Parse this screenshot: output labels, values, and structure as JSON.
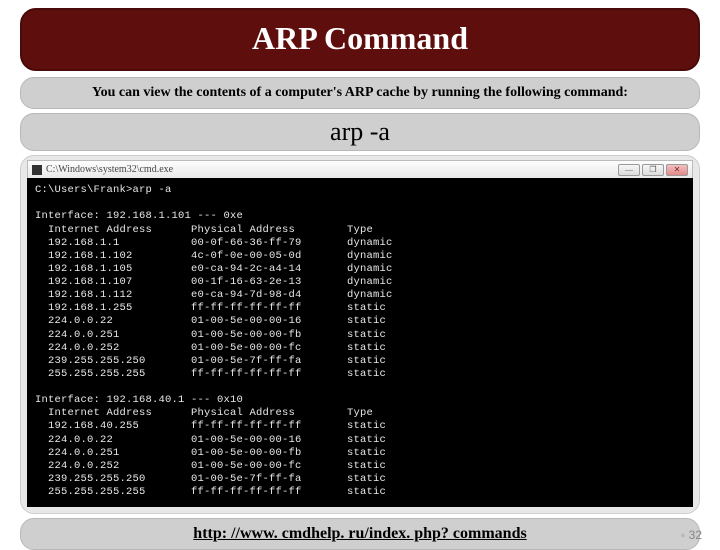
{
  "title": "ARP Command",
  "subtitle": "You can view the contents of a computer's ARP cache by running the following command:",
  "command": "arp -a",
  "window_title": "C:\\Windows\\system32\\cmd.exe",
  "prompt_line": "C:\\Users\\Frank>arp -a",
  "interfaces": [
    {
      "header": "Interface: 192.168.1.101 --- 0xe",
      "col1": "Internet Address",
      "col2": "Physical Address",
      "col3": "Type",
      "rows": [
        {
          "ip": "192.168.1.1",
          "mac": "00-0f-66-36-ff-79",
          "type": "dynamic"
        },
        {
          "ip": "192.168.1.102",
          "mac": "4c-0f-0e-00-05-0d",
          "type": "dynamic"
        },
        {
          "ip": "192.168.1.105",
          "mac": "e0-ca-94-2c-a4-14",
          "type": "dynamic"
        },
        {
          "ip": "192.168.1.107",
          "mac": "00-1f-16-63-2e-13",
          "type": "dynamic"
        },
        {
          "ip": "192.168.1.112",
          "mac": "e0-ca-94-7d-98-d4",
          "type": "dynamic"
        },
        {
          "ip": "192.168.1.255",
          "mac": "ff-ff-ff-ff-ff-ff",
          "type": "static"
        },
        {
          "ip": "224.0.0.22",
          "mac": "01-00-5e-00-00-16",
          "type": "static"
        },
        {
          "ip": "224.0.0.251",
          "mac": "01-00-5e-00-00-fb",
          "type": "static"
        },
        {
          "ip": "224.0.0.252",
          "mac": "01-00-5e-00-00-fc",
          "type": "static"
        },
        {
          "ip": "239.255.255.250",
          "mac": "01-00-5e-7f-ff-fa",
          "type": "static"
        },
        {
          "ip": "255.255.255.255",
          "mac": "ff-ff-ff-ff-ff-ff",
          "type": "static"
        }
      ]
    },
    {
      "header": "Interface: 192.168.40.1 --- 0x10",
      "col1": "Internet Address",
      "col2": "Physical Address",
      "col3": "Type",
      "rows": [
        {
          "ip": "192.168.40.255",
          "mac": "ff-ff-ff-ff-ff-ff",
          "type": "static"
        },
        {
          "ip": "224.0.0.22",
          "mac": "01-00-5e-00-00-16",
          "type": "static"
        },
        {
          "ip": "224.0.0.251",
          "mac": "01-00-5e-00-00-fb",
          "type": "static"
        },
        {
          "ip": "224.0.0.252",
          "mac": "01-00-5e-00-00-fc",
          "type": "static"
        },
        {
          "ip": "239.255.255.250",
          "mac": "01-00-5e-7f-ff-fa",
          "type": "static"
        },
        {
          "ip": "255.255.255.255",
          "mac": "ff-ff-ff-ff-ff-ff",
          "type": "static"
        }
      ]
    }
  ],
  "link_text": "http: //www. cmdhelp. ru/index. php? commands",
  "link_href": "http://www.cmdhelp.ru/index.php?commands",
  "page_number": "32",
  "win_buttons": {
    "min": "—",
    "max": "❐",
    "close": "✕"
  }
}
